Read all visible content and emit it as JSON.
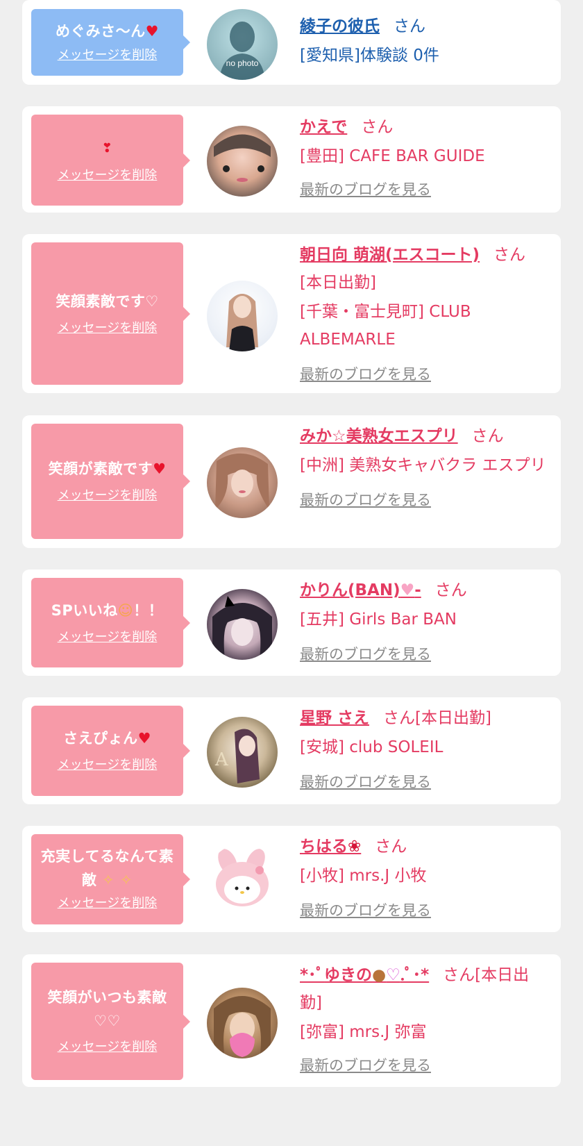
{
  "delete_label": "メッセージを削除",
  "blog_label": "最新のブログを見る",
  "honorific": "さん",
  "items": [
    {
      "message": "めぐみさ〜ん",
      "name": "綾子の彼氏",
      "shop": "[愛知県]体験談 0件",
      "avatar_text": "no photo"
    },
    {
      "message": "",
      "name": "かえで",
      "shop": "[豊田] CAFE BAR GUIDE"
    },
    {
      "message": "笑顔素敵です♡",
      "name": "朝日向 萌湖(エスコート)",
      "status": "[本日出勤]",
      "shop": "[千葉・富士見町] CLUB ALBEMARLE"
    },
    {
      "message": "笑顔が素敵です",
      "name": "みか☆美熟女エスプリ",
      "shop": "[中洲] 美熟女キャバクラ エスプリ"
    },
    {
      "message": "SPいいね",
      "message_suffix": "！！",
      "name": "かりん(BAN)",
      "name_suffix": "-",
      "shop": "[五井] Girls Bar BAN"
    },
    {
      "message": "さえぴょん",
      "name": "星野 さえ",
      "status": "[本日出勤]",
      "shop": "[安城] club SOLEIL"
    },
    {
      "message": "充実してるなんて素敵",
      "name": "ちはる",
      "shop": "[小牧] mrs.J 小牧"
    },
    {
      "message": "笑顔がいつも素敵♡♡",
      "name_prefix": "*･ﾟ",
      "name": "ゆきの",
      "name_suffix": ".ﾟ･*",
      "status": "[本日出勤]",
      "shop": "[弥富] mrs.J 弥富"
    }
  ],
  "colors": {
    "background": "#efefef",
    "card": "#ffffff",
    "bubble_pink": "#f79aa8",
    "bubble_blue": "#8dbbf4",
    "name_pink": "#e43b62",
    "name_blue": "#1d5fae",
    "link_gray": "#8a8a8a"
  },
  "icons": [
    "heart-icon",
    "double-heart-icon",
    "cat-face-icon",
    "sparkles-icon",
    "bear-icon",
    "rose-icon",
    "pink-heart-icon"
  ]
}
